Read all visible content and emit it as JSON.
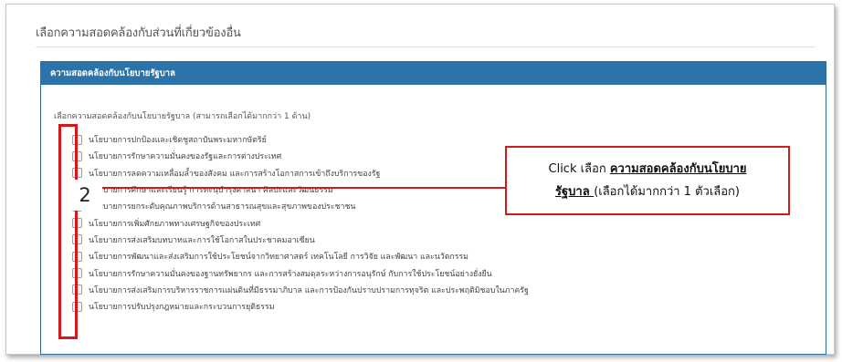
{
  "section": {
    "title": "เลือกความสอดคล้องกับส่วนที่เกี่ยวข้องอื่น"
  },
  "panel": {
    "header": "ความสอดคล้องกับนโยบายรัฐบาล",
    "instruction": "เลือกความสอดคล้องกับนโยบายรัฐบาล (สามารถเลือกได้มากกว่า 1 ด้าน)",
    "options": [
      {
        "label": "นโยบายการปกป้องและเชิดชูสถาบันพระมหากษัตริย์",
        "checked": false
      },
      {
        "label": "นโยบายการรักษาความมั่นคงของรัฐและการต่างประเทศ",
        "checked": false
      },
      {
        "label": "นโยบายการลดความเหลื่อมล้ำของสังคม และการสร้างโอกาสการเข้าถึงบริการของรัฐ",
        "checked": false
      },
      {
        "label": "นโยบายการศึกษาและเรียนรู้ การทะนุบำรุงศาสนา ศิลปะและวัฒนธรรม",
        "checked": false
      },
      {
        "label": "นโยบายการยกระดับคุณภาพบริการด้านสาธารณสุขและสุขภาพของประชาชน",
        "checked": false
      },
      {
        "label": "นโยบายการเพิ่มศักยภาพทางเศรษฐกิจของประเทศ",
        "checked": false
      },
      {
        "label": "นโยบายการส่งเสริมบทบาทและการใช้โอกาสในประชาคมอาเซียน",
        "checked": false
      },
      {
        "label": "นโยบายการพัฒนาและส่งเสริมการใช้ประโยชน์จากวิทยาศาสตร์ เทคโนโลยี การวิจัย และพัฒนา และนวัตกรรม",
        "checked": false
      },
      {
        "label": "นโยบายการรักษาความมั่นคงของฐานทรัพยากร และการสร้างสมดุลระหว่างการอนุรักษ์ กับการใช้ประโยชน์อย่างยั่งยืน",
        "checked": false
      },
      {
        "label": "นโยบายการส่งเสริมการบริหารราชการแผ่นดินที่มีธรรมาภิบาล และการป้องกันปราบปรามการทุจริต และประพฤติมิชอบในภาครัฐ",
        "checked": false
      },
      {
        "label": "นโยบายการปรับปรุงกฎหมายและกระบวนการยุติธรรม",
        "checked": false
      }
    ]
  },
  "annotation": {
    "step_number": "2",
    "callout_prefix": "Click เลือก ",
    "callout_underlined_1": "ความสอดคล้องกับนโยบาย",
    "callout_underlined_2": "รัฐบาล ",
    "callout_suffix": "(เลือกได้มากกว่า 1 ตัวเลือก)",
    "highlight_color": "#d11a1a"
  },
  "colors": {
    "panel_header_bg": "#2b73a8"
  }
}
